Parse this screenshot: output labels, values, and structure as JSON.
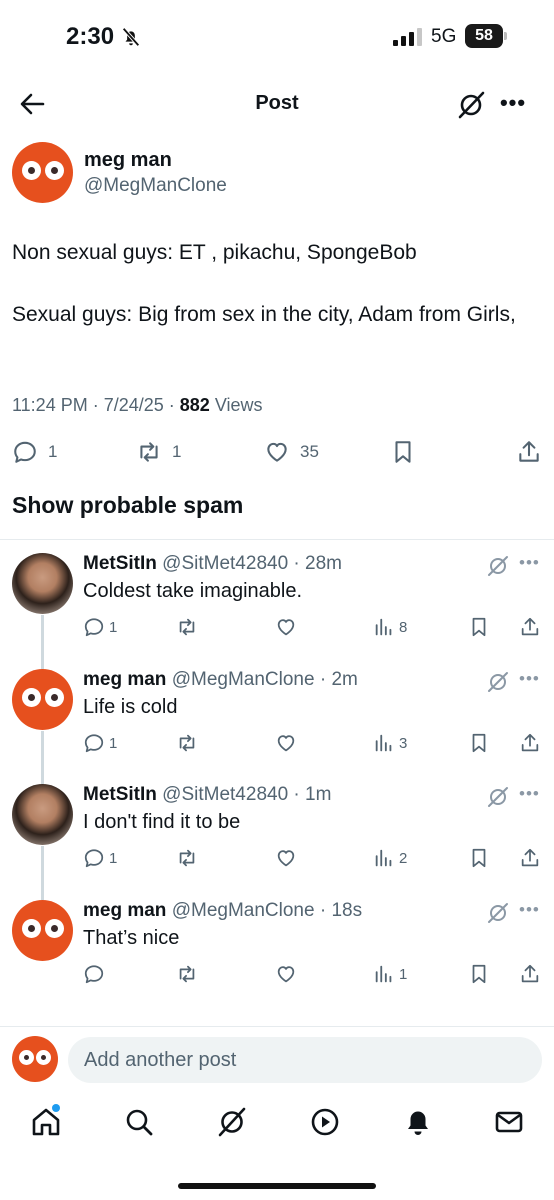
{
  "status_bar": {
    "time": "2:30",
    "network": "5G",
    "battery": "58"
  },
  "nav": {
    "title": "Post",
    "icons": [
      "back-arrow-icon",
      "grok-icon",
      "more-icon"
    ]
  },
  "post": {
    "author_name": "meg man",
    "author_handle": "@MegManClone",
    "text": "Non sexual guys:  ET , pikachu, SpongeBob\n\nSexual guys: Big from sex in the city, Adam from Girls,",
    "time": "11:24 PM",
    "date": "7/24/25",
    "views_count": "882",
    "views_label": "Views",
    "replies": "1",
    "reposts": "1",
    "likes": "35"
  },
  "spam_label": "Show probable spam",
  "replies": [
    {
      "name": "MetSitIn",
      "handle": "@SitMet42840",
      "time": "28m",
      "text": "Coldest take imaginable.",
      "replies": "1",
      "views": "8",
      "avatar": "photo"
    },
    {
      "name": "meg man",
      "handle": "@MegManClone",
      "time": "2m",
      "text": "Life is cold",
      "replies": "1",
      "views": "3",
      "avatar": "eyes"
    },
    {
      "name": "MetSitIn",
      "handle": "@SitMet42840",
      "time": "1m",
      "text": "I don't find it to be",
      "replies": "1",
      "views": "2",
      "avatar": "photo"
    },
    {
      "name": "meg man",
      "handle": "@MegManClone",
      "time": "18s",
      "text": "That’s nice",
      "replies": "",
      "views": "1",
      "avatar": "eyes"
    }
  ],
  "composer": {
    "placeholder": "Add another post"
  },
  "tabbar": {
    "icons": [
      "home-icon",
      "search-icon",
      "grok-icon",
      "video-icon",
      "notifications-icon",
      "messages-icon"
    ]
  },
  "colors": {
    "accent": "#1d9bf0",
    "avatar_orange": "#e6501e",
    "secondary_text": "#536471"
  }
}
